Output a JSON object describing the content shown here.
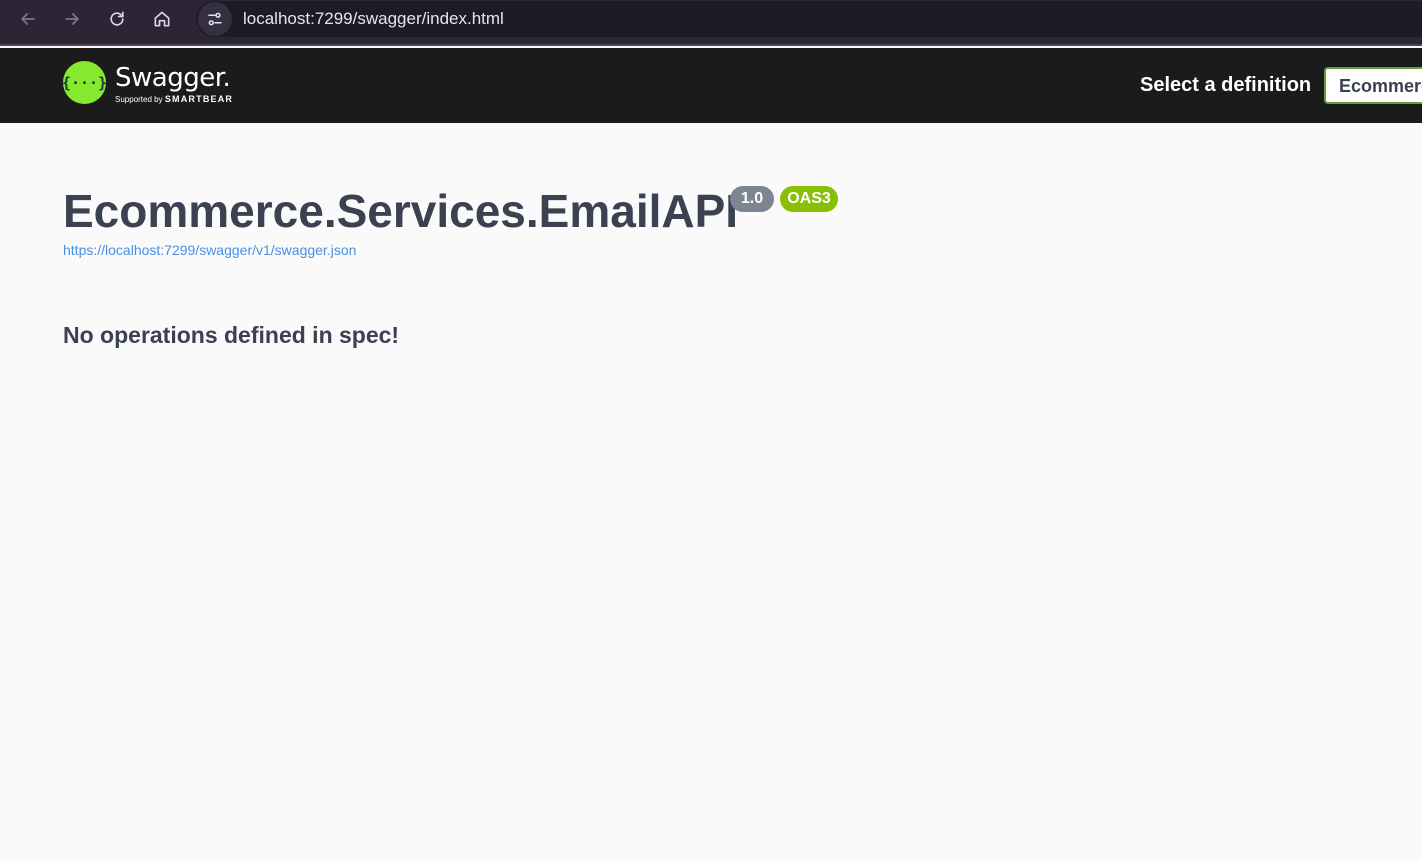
{
  "browser": {
    "url": "localhost:7299/swagger/index.html",
    "icons": {
      "back": "arrow-left-icon",
      "forward": "arrow-right-icon",
      "reload": "reload-icon",
      "home": "home-icon",
      "site_info": "site-settings-icon"
    }
  },
  "topbar": {
    "logo_glyph": "{···}",
    "logo_name": "Swagger.",
    "logo_supported_by": "Supported by",
    "logo_company": "SMARTBEAR",
    "select_label": "Select a definition",
    "selected_definition": "Ecommerce"
  },
  "info": {
    "title": "Ecommerce.Services.EmailAPI",
    "version": "1.0",
    "spec_version": "OAS3",
    "spec_url": "https://localhost:7299/swagger/v1/swagger.json"
  },
  "main": {
    "message": "No operations defined in spec!"
  },
  "colors": {
    "browser_bar": "#2b2535",
    "topbar": "#1b1b1b",
    "swagger_green": "#85ea2d",
    "version_badge": "#7d8492",
    "oas_badge": "#89bf04",
    "link": "#4990e2",
    "text": "#3b4151"
  }
}
